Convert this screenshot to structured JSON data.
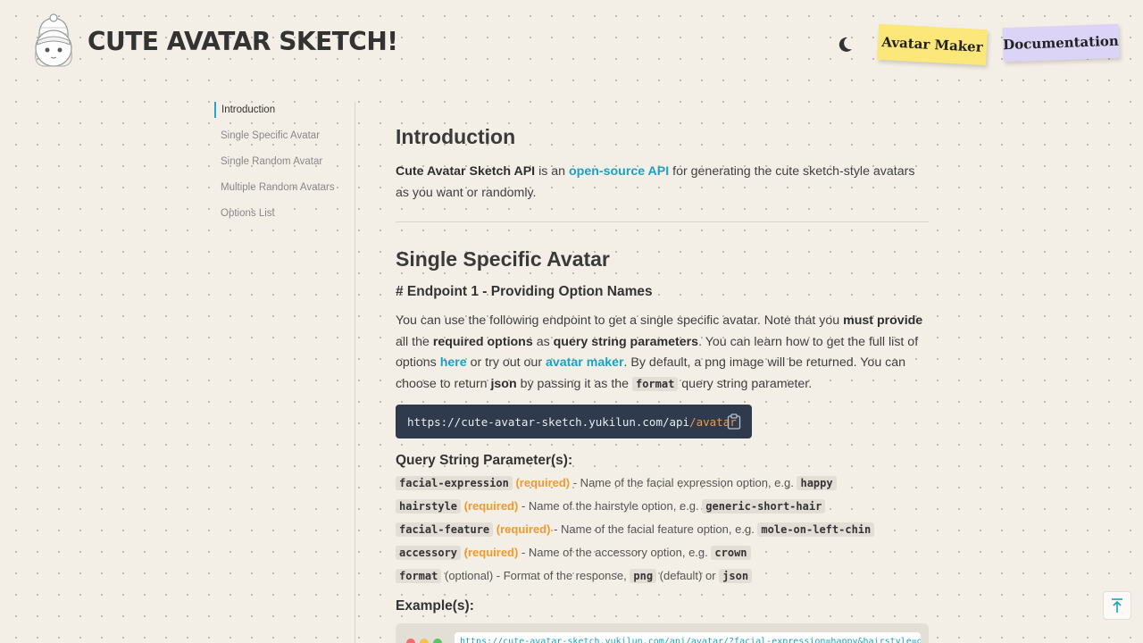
{
  "header": {
    "brand": "CUTE AVATAR SKETCH!",
    "nav_avatar_maker": "Avatar Maker",
    "nav_documentation": "Documentation"
  },
  "sidebar": {
    "items": [
      {
        "label": "Introduction"
      },
      {
        "label": "Single Specific Avatar"
      },
      {
        "label": "Single Random Avatar"
      },
      {
        "label": "Multiple Random Avatars"
      },
      {
        "label": "Options List"
      }
    ]
  },
  "intro": {
    "title": "Introduction",
    "api_name": "Cute Avatar Sketch API",
    "is_an": " is an ",
    "link": "open-source API",
    "rest": " for generating the cute sketch-style avatars as you want or randomly."
  },
  "single": {
    "title": "Single Specific Avatar",
    "endpoint_heading": "# Endpoint 1 - Providing Option Names",
    "p1": "You can use the following endpoint to get a single specific avatar. Note that you ",
    "b1": "must provide",
    "p2": " all the ",
    "b2": "required options",
    "p3": " as ",
    "b3": "query string parameters",
    "p4": ". You can learn how to get the full list of options ",
    "link_here": "here",
    "p5": " or try out our ",
    "link_maker": "avatar maker",
    "p6": ". By default, a png image will be returned. You can choose to return ",
    "b4": "json",
    "p7": " by passing it as the ",
    "code_format": "format",
    "p8": " query string parameter.",
    "endpoint_base": "https://cute-avatar-sketch.yukilun.com/api",
    "endpoint_path": "/avatar",
    "params_title": "Query String Parameter(s):",
    "params": [
      {
        "name": "facial-expression",
        "flag": "(required)",
        "desc": " - Name of the facial expression option, e.g. ",
        "example": "happy",
        "required": true
      },
      {
        "name": "hairstyle",
        "flag": "(required)",
        "desc": " - Name of the hairstyle option, e.g. ",
        "example": "generic-short-hair",
        "required": true
      },
      {
        "name": "facial-feature",
        "flag": "(required)",
        "desc": " - Name of the facial feature option, e.g. ",
        "example": "mole-on-left-chin",
        "required": true
      },
      {
        "name": "accessory",
        "flag": "(required)",
        "desc": " - Name of the accessory option, e.g. ",
        "example": "crown",
        "required": true
      }
    ],
    "format_param": {
      "name": "format",
      "flag": "(optional)",
      "desc": " - Format of the response, ",
      "opt1": "png",
      "mid": " (default) or ",
      "opt2": "json"
    },
    "examples_title": "Example(s):",
    "example_url": "https://cute-avatar-sketch.yukilun.com/api/avatar/?facial-expression=happy&hairstyle=generic-short"
  },
  "colors": {
    "accent": "#1aa2c2",
    "required": "#f19a2c",
    "note_yellow": "#fbe77a",
    "note_purple": "#dcd4f7",
    "code_bg": "#2f3b4c"
  },
  "icons": [
    "avatar-logo-icon",
    "moon-icon",
    "clipboard-icon",
    "back-to-top-icon"
  ]
}
